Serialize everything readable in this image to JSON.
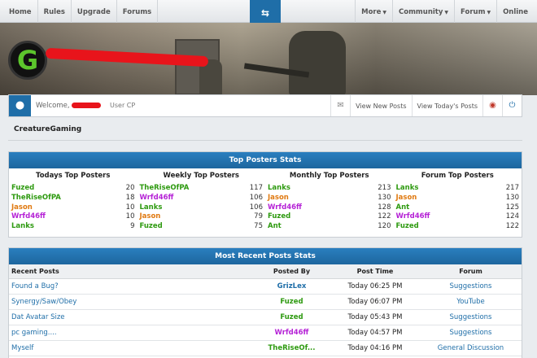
{
  "nav": {
    "left": [
      "Home",
      "Rules",
      "Upgrade",
      "Forums"
    ],
    "right": [
      {
        "label": "More",
        "dropdown": true
      },
      {
        "label": "Community",
        "dropdown": true
      },
      {
        "label": "Forum",
        "dropdown": true
      },
      {
        "label": "Online",
        "dropdown": false
      }
    ],
    "toggle_glyph": "⇆"
  },
  "banner": {
    "logo_letter": "G"
  },
  "userbar": {
    "welcome": "Welcome,",
    "user_cp": "User CP",
    "links": [
      "View New Posts",
      "View Today's Posts"
    ]
  },
  "site_title": "CreatureGaming",
  "colors": {
    "accent": "#1f6ea8",
    "green": "#2e9a10",
    "orange": "#e07a12",
    "magenta": "#b522d6",
    "redaction": "#e8141b"
  },
  "top_posters": {
    "title": "Top Posters Stats",
    "columns": [
      {
        "header": "Todays Top Posters",
        "rows": [
          {
            "name": "Fuzed",
            "count": "20",
            "color": "#2e9a10"
          },
          {
            "name": "TheRiseOfPA",
            "count": "18",
            "color": "#2e9a10"
          },
          {
            "name": "Jason",
            "count": "10",
            "color": "#e07a12"
          },
          {
            "name": "Wrfd46ff",
            "count": "10",
            "color": "#b522d6"
          },
          {
            "name": "Lanks",
            "count": "9",
            "color": "#2e9a10"
          }
        ]
      },
      {
        "header": "Weekly Top Posters",
        "rows": [
          {
            "name": "TheRiseOfPA",
            "count": "117",
            "color": "#2e9a10"
          },
          {
            "name": "Wrfd46ff",
            "count": "106",
            "color": "#b522d6"
          },
          {
            "name": "Lanks",
            "count": "106",
            "color": "#2e9a10"
          },
          {
            "name": "Jason",
            "count": "79",
            "color": "#e07a12"
          },
          {
            "name": "Fuzed",
            "count": "75",
            "color": "#2e9a10"
          }
        ]
      },
      {
        "header": "Monthly Top Posters",
        "rows": [
          {
            "name": "Lanks",
            "count": "213",
            "color": "#2e9a10"
          },
          {
            "name": "Jason",
            "count": "130",
            "color": "#e07a12"
          },
          {
            "name": "Wrfd46ff",
            "count": "128",
            "color": "#b522d6"
          },
          {
            "name": "Fuzed",
            "count": "122",
            "color": "#2e9a10"
          },
          {
            "name": "Ant",
            "count": "120",
            "color": "#2e9a10"
          }
        ]
      },
      {
        "header": "Forum Top Posters",
        "rows": [
          {
            "name": "Lanks",
            "count": "217",
            "color": "#2e9a10"
          },
          {
            "name": "Jason",
            "count": "130",
            "color": "#e07a12"
          },
          {
            "name": "Ant",
            "count": "125",
            "color": "#2e9a10"
          },
          {
            "name": "Wrfd46ff",
            "count": "124",
            "color": "#b522d6"
          },
          {
            "name": "Fuzed",
            "count": "122",
            "color": "#2e9a10"
          }
        ]
      }
    ]
  },
  "recent_posts": {
    "title": "Most Recent Posts Stats",
    "headers": [
      "Recent Posts",
      "Posted By",
      "Post Time",
      "Forum"
    ],
    "rows": [
      {
        "title": "Found a Bug?",
        "by": "GrizLex",
        "by_color": "#1f6ea8",
        "time": "Today 06:25 PM",
        "forum": "Suggestions"
      },
      {
        "title": "Synergy/Saw/Obey",
        "by": "Fuzed",
        "by_color": "#2e9a10",
        "time": "Today 06:07 PM",
        "forum": "YouTube"
      },
      {
        "title": "Dat Avatar Size",
        "by": "Fuzed",
        "by_color": "#2e9a10",
        "time": "Today 05:43 PM",
        "forum": "Suggestions"
      },
      {
        "title": "pc gaming....",
        "by": "Wrfd46ff",
        "by_color": "#b522d6",
        "time": "Today 04:57 PM",
        "forum": "Suggestions"
      },
      {
        "title": "Myself",
        "by": "TheRiseOf...",
        "by_color": "#2e9a10",
        "time": "Today 04:16 PM",
        "forum": "General Discussion"
      }
    ]
  }
}
